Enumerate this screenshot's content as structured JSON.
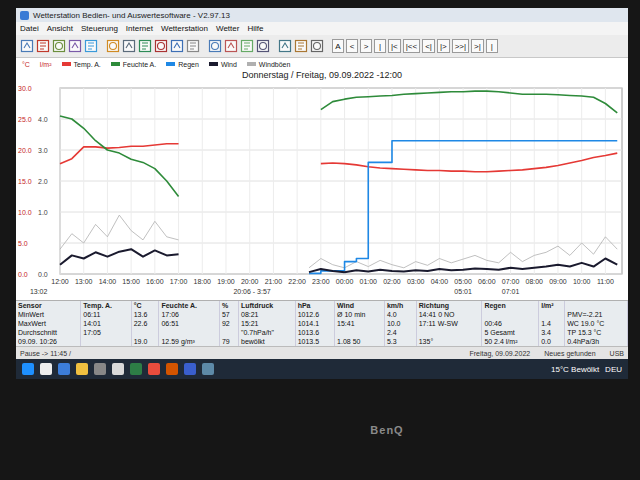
{
  "window": {
    "title": "Wetterstation Bedien- und Auswertesoftware - V2.97.13"
  },
  "menu": [
    "Datei",
    "Ansicht",
    "Steuerung",
    "Internet",
    "Wetterstation",
    "Wetter",
    "Hilfe"
  ],
  "toolbar": {
    "nav_buttons": [
      "A",
      "<",
      ">",
      "|",
      "|<",
      "|<<",
      "<|",
      "|>",
      ">>|",
      ">|",
      "|"
    ]
  },
  "chart": {
    "title": "Donnerstag / Freitag, 09.09.2022 -12:00",
    "units": [
      "°C",
      "l/m²"
    ],
    "series": [
      {
        "name": "Temp. A.",
        "color": "#e53935",
        "kind": "line",
        "values": [
          17.8,
          18.6,
          20.5,
          20.5,
          20.3,
          20.4,
          20.6,
          20.6,
          20.8,
          21.0,
          21.0,
          null,
          null,
          null,
          null,
          null,
          null,
          null,
          null,
          null,
          null,
          null,
          17.8,
          17.9,
          17.8,
          17.6,
          17.3,
          17.1,
          17.0,
          16.9,
          16.8,
          16.7,
          16.7,
          16.6,
          16.6,
          16.5,
          16.5,
          16.6,
          16.7,
          16.8,
          17.0,
          17.2,
          17.5,
          17.9,
          18.3,
          18.8,
          19.1,
          19.5
        ]
      },
      {
        "name": "Feuchte A.",
        "color": "#2e8b3a",
        "kind": "line",
        "values": [
          25.5,
          25.0,
          23.5,
          21.5,
          20.0,
          19.5,
          18.5,
          18.0,
          17.0,
          15.0,
          12.5,
          null,
          null,
          null,
          null,
          null,
          null,
          null,
          null,
          null,
          null,
          null,
          26.5,
          27.8,
          28.2,
          28.5,
          28.6,
          28.7,
          28.8,
          29.0,
          29.1,
          29.2,
          29.3,
          29.4,
          29.4,
          29.5,
          29.5,
          29.4,
          29.2,
          29.0,
          29.0,
          29.0,
          28.9,
          28.8,
          28.7,
          28.5,
          27.5,
          26.0
        ]
      },
      {
        "name": "Regen",
        "color": "#1e88e5",
        "kind": "step",
        "values": [
          null,
          null,
          null,
          null,
          null,
          null,
          null,
          null,
          null,
          null,
          null,
          null,
          null,
          null,
          null,
          null,
          null,
          null,
          null,
          null,
          null,
          0.1,
          0.5,
          0.5,
          2.0,
          2.5,
          18.0,
          18.0,
          21.5,
          21.5,
          21.5,
          21.5,
          21.5,
          21.5,
          21.5,
          21.5,
          21.5,
          21.5,
          21.5,
          21.5,
          21.5,
          21.5,
          21.5,
          21.5,
          21.5,
          21.5,
          21.5,
          21.5
        ]
      },
      {
        "name": "Wind",
        "color": "#1a1a2e",
        "kind": "bold",
        "values": [
          1.5,
          3.0,
          2.5,
          3.5,
          2.8,
          3.6,
          4.0,
          2.8,
          3.8,
          3.0,
          3.2,
          null,
          null,
          null,
          null,
          null,
          null,
          null,
          null,
          null,
          null,
          0.3,
          0.8,
          0.5,
          0.3,
          0.6,
          0.4,
          0.7,
          0.5,
          0.4,
          0.6,
          0.5,
          0.8,
          0.6,
          0.7,
          0.9,
          0.8,
          0.7,
          1.0,
          0.8,
          1.0,
          1.2,
          1.5,
          1.2,
          1.8,
          1.2,
          2.5,
          1.5
        ]
      },
      {
        "name": "Windböen",
        "color": "#b0b0b0",
        "kind": "thin",
        "values": [
          4.0,
          6.5,
          5.0,
          8.0,
          6.0,
          9.5,
          7.0,
          5.5,
          8.5,
          6.0,
          5.5,
          null,
          null,
          null,
          null,
          null,
          null,
          null,
          null,
          null,
          null,
          1.0,
          2.5,
          1.5,
          1.0,
          2.0,
          1.2,
          2.2,
          1.5,
          1.0,
          2.0,
          1.4,
          2.5,
          1.8,
          2.4,
          3.0,
          2.2,
          1.8,
          3.5,
          2.0,
          3.0,
          3.5,
          4.5,
          3.0,
          5.0,
          3.2,
          6.0,
          4.0
        ]
      }
    ],
    "y_ticks_left": [
      {
        "value": 30,
        "label": "30.0"
      },
      {
        "value": 25,
        "label": "25.0"
      },
      {
        "value": 20,
        "label": "20.0"
      },
      {
        "value": 15,
        "label": "15.0"
      },
      {
        "value": 10,
        "label": "10.0"
      },
      {
        "value": 5,
        "label": "5.0"
      },
      {
        "value": 0,
        "label": "0.0"
      }
    ],
    "y_ticks_right": [
      {
        "value": 25,
        "label": "4.0"
      },
      {
        "value": 20,
        "label": "3.0"
      },
      {
        "value": 15,
        "label": "2.0"
      },
      {
        "value": 10,
        "label": "1.0"
      },
      {
        "value": 0,
        "label": "0.0"
      }
    ],
    "x_ticks": [
      "12:00",
      "13:00",
      "14:00",
      "15:00",
      "16:00",
      "17:00",
      "18:00",
      "19:00",
      "20:00",
      "21:00",
      "22:00",
      "23:00",
      "00:00",
      "01:00",
      "02:00",
      "03:00",
      "04:00",
      "05:00",
      "06:00",
      "07:00",
      "08:00",
      "09:00",
      "10:00",
      "11:00"
    ],
    "notes": [
      {
        "label": "13:02",
        "at": -0.9
      },
      {
        "label": "20:06 - 3:57",
        "at": 8.1
      },
      {
        "label": "05:01",
        "at": 17.0
      },
      {
        "label": "07:01",
        "at": 19.0
      }
    ]
  },
  "table": {
    "columns": [
      "Sensor",
      "Temp. A.",
      "°C",
      "Feuchte A.",
      "%",
      "Luftdruck",
      "hPa",
      "Wind",
      "km/h",
      "Richtung",
      "Regen",
      "l/m²",
      ""
    ],
    "rows": [
      [
        "MinWert",
        "06:11",
        "13.6",
        "17:06",
        "57",
        "08:21",
        "1012.6",
        "Ø 10 min",
        "4.0",
        "14:41 0 NO",
        "",
        "",
        "PMV=-2.21"
      ],
      [
        "MaxWert",
        "14:01",
        "22.6",
        "06:51",
        "92",
        "15:21",
        "1014.1",
        "15:41",
        "10.0",
        "17:11 W-SW",
        "00:46",
        "1.4",
        "WC 19.0 °C"
      ],
      [
        "Durchschnitt",
        "17:05",
        "",
        "",
        "",
        "\"0.7hPa/h\"",
        "1013.6",
        "",
        "2.4",
        "",
        "5 Gesamt",
        "3.4",
        "TP 15.3 °C"
      ],
      [
        "09.09. 10:26",
        "",
        "19.0",
        "12.59 g/m³",
        "79",
        "bewölkt",
        "1013.5",
        "1.08 50",
        "5.3",
        "135°",
        "50 2.4 l/m²",
        "0.0",
        "0.4hPa/3h"
      ]
    ]
  },
  "status_bar": [
    "Pause -> 11:45 /",
    "Freitag, 09.09.2022",
    "Neues gefunden",
    "USB"
  ],
  "taskbar": {
    "weather": "15°C Bewölkt",
    "language": "DEU"
  },
  "monitor": {
    "brand": "BenQ"
  }
}
